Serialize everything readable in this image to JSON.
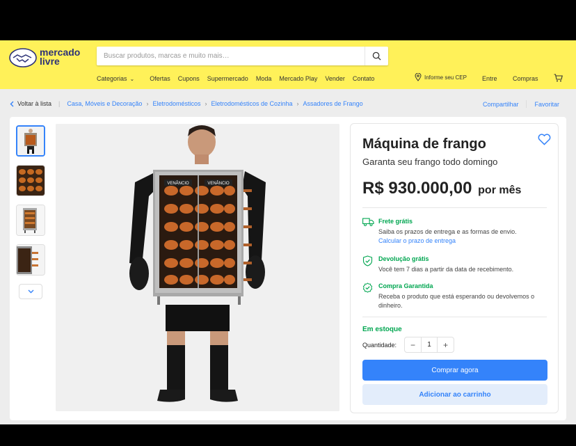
{
  "header": {
    "logo_line1": "mercado",
    "logo_line2": "livre",
    "search_placeholder": "Buscar produtos, marcas e muito mais…",
    "nav": [
      "Categorias",
      "Ofertas",
      "Cupons",
      "Supermercado",
      "Moda",
      "Mercado Play",
      "Vender",
      "Contato"
    ],
    "cep_label": "Informe seu CEP",
    "entre": "Entre",
    "compras": "Compras"
  },
  "breadcrumb": {
    "back": "Voltar à lista",
    "items": [
      "Casa, Móveis e Decoração",
      "Eletrodomésticos",
      "Eletrodomésticos de Cozinha",
      "Assadores de Frango"
    ],
    "share": "Compartilhar",
    "favorite": "Favoritar"
  },
  "gallery": {
    "brand": "VENÂNCIO"
  },
  "product": {
    "title": "Máquina de frango",
    "subtitle": "Garanta seu frango todo domingo",
    "price": "R$ 930.000,00",
    "price_period": "por mês",
    "shipping_title": "Frete grátis",
    "shipping_desc": "Saiba os prazos de entrega e as formas de envio.",
    "shipping_link": "Calcular o prazo de entrega",
    "return_title": "Devolução grátis",
    "return_desc": "Você tem 7 dias a partir da data de recebimento.",
    "guarantee_title": "Compra Garantida",
    "guarantee_desc": "Receba o produto que está esperando ou devolvemos o dinheiro.",
    "stock": "Em estoque",
    "qty_label": "Quantidade:",
    "qty_value": "1",
    "buy_now": "Comprar agora",
    "add_cart": "Adicionar ao carrinho"
  },
  "colors": {
    "header_yellow": "#fff159",
    "accent_blue": "#3483fa",
    "success_green": "#00a650"
  }
}
